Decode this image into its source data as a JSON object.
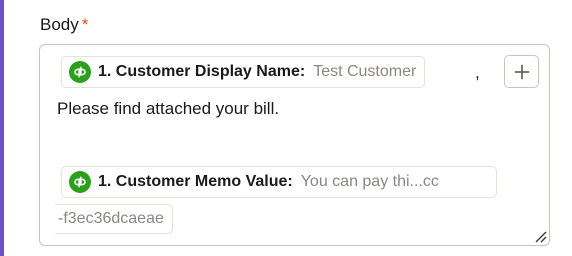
{
  "field": {
    "label": "Body",
    "required_mark": "*"
  },
  "body_editor": {
    "line1": {
      "token": {
        "app_icon": "quickbooks-icon",
        "label": "1. Customer Display Name:",
        "value": "Test Customer"
      },
      "trailing_text": ","
    },
    "line2_text": "Please find attached your bill.",
    "line3": {
      "token": {
        "app_icon": "quickbooks-icon",
        "label": "1. Customer Memo Value:",
        "value": "You can pay thi...cc",
        "value_continued": "-f3ec36dcaeae"
      }
    },
    "add_button_icon": "plus-icon",
    "resize_icon": "resize-grip-icon"
  },
  "colors": {
    "accent_left_bar": "#6a4fc8",
    "required_star": "#e0511e",
    "quickbooks_green": "#2ca01c",
    "token_value_text": "#8b8781"
  }
}
